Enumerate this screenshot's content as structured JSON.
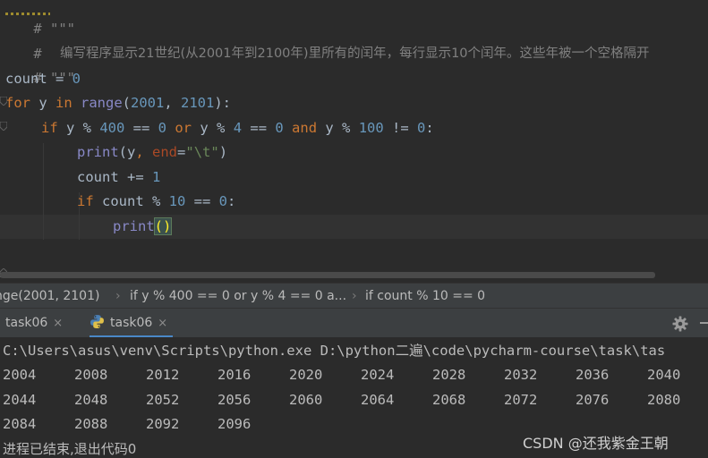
{
  "editor": {
    "comment_open": "# \"\"\"",
    "comment_hash": "#",
    "comment_text": "编写程序显示21世纪(从2001年到2100年)里所有的闰年，每行显示10个闰年。这些年被一个空格隔开",
    "comment_close": "# \"\"\"",
    "code": {
      "l1_var": "count",
      "l1_op": " = ",
      "l1_num": "0",
      "l2_for": "for",
      "l2_y": " y ",
      "l2_in": "in",
      "l2_range": " range",
      "l2_open": "(",
      "l2_a": "2001",
      "l2_comma": ", ",
      "l2_b": "2101",
      "l2_close": "):",
      "l3_if": "if",
      "l3_t1": " y % ",
      "l3_n400": "400",
      "l3_t2": " == ",
      "l3_n0a": "0",
      "l3_or": " or",
      "l3_t3": " y % ",
      "l3_n4": "4",
      "l3_t4": " == ",
      "l3_n0b": "0",
      "l3_and": " and",
      "l3_t5": " y % ",
      "l3_n100": "100",
      "l3_t6": " != ",
      "l3_n0c": "0",
      "l3_colon": ":",
      "l4_print": "print",
      "l4_t1": "(y",
      "l4_comma": ", ",
      "l4_end": "end",
      "l4_eq": "=",
      "l4_str": "\"\\t\"",
      "l4_close": ")",
      "l5_text": "count += ",
      "l5_num": "1",
      "l6_if": "if",
      "l6_t1": " count % ",
      "l6_n10": "10",
      "l6_t2": " == ",
      "l6_n0": "0",
      "l6_colon": ":",
      "l7_print": "print",
      "l7_parens": "()"
    },
    "trailing": "\"\"\""
  },
  "breadcrumbs": [
    "nge(2001, 2101)",
    "if y % 400 == 0 or y % 4 == 0 a...",
    "if count % 10 == 0"
  ],
  "run_tabs": [
    {
      "label": "task06",
      "close": "×"
    },
    {
      "label": "task06",
      "close": "×"
    }
  ],
  "console": {
    "command": "C:\\Users\\asus\\venv\\Scripts\\python.exe D:\\python二遍\\code\\pycharm-course\\task\\tas",
    "rows": [
      [
        "2004",
        "2008",
        "2012",
        "2016",
        "2020",
        "2024",
        "2028",
        "2032",
        "2036",
        "2040"
      ],
      [
        "2044",
        "2048",
        "2052",
        "2056",
        "2060",
        "2064",
        "2068",
        "2072",
        "2076",
        "2080"
      ],
      [
        "2084",
        "2088",
        "2092",
        "2096"
      ]
    ],
    "finished": "进程已结束,退出代码0"
  },
  "watermark": "CSDN @还我紫金王朝",
  "colors": {
    "editor_bg": "#2b2b2b",
    "keyword": "#cc7832",
    "number": "#6897bb",
    "string": "#6a8759",
    "builtin": "#8888c6",
    "comment": "#808080",
    "tab_underline": "#4a88c7"
  }
}
